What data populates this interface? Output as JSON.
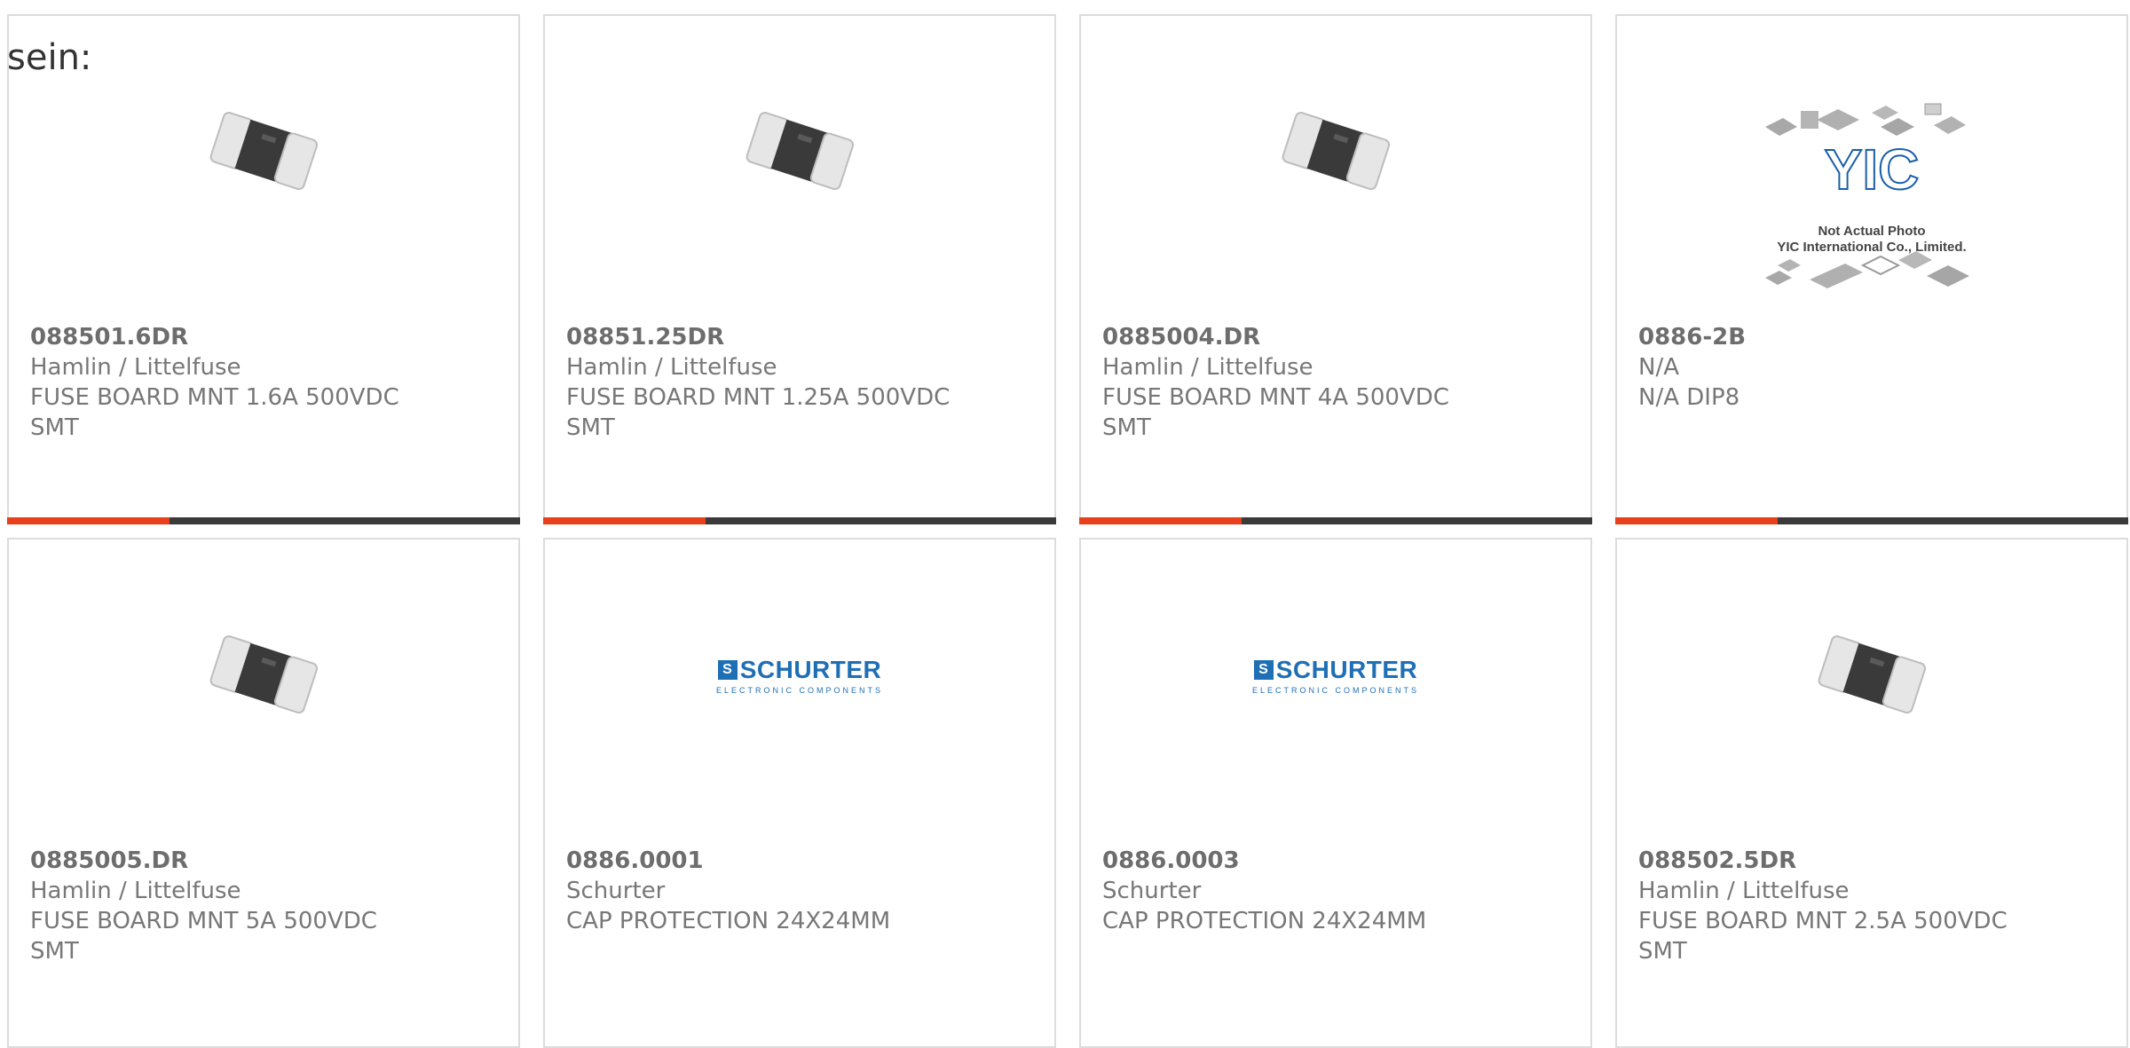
{
  "page": {
    "label": "sein:"
  },
  "colors": {
    "accent": "#e8401c",
    "bar": "#3a3a3a",
    "border": "#dcdcdc",
    "text": "#777777",
    "schurter_blue": "#1f6fb5"
  },
  "products": [
    {
      "part_number": "088501.6DR",
      "manufacturer": "Hamlin / Littelfuse",
      "description": "FUSE BOARD MNT 1.6A 500VDC",
      "package": "SMT",
      "image": "smd-fuse-icon"
    },
    {
      "part_number": "08851.25DR",
      "manufacturer": "Hamlin / Littelfuse",
      "description": "FUSE BOARD MNT 1.25A 500VDC",
      "package": "SMT",
      "image": "smd-fuse-icon"
    },
    {
      "part_number": "0885004.DR",
      "manufacturer": "Hamlin / Littelfuse",
      "description": "FUSE BOARD MNT 4A 500VDC",
      "package": "SMT",
      "image": "smd-fuse-icon"
    },
    {
      "part_number": "0886-2B",
      "manufacturer": "N/A",
      "description": "N/A DIP8",
      "package": "",
      "image": "yic-placeholder-logo",
      "image_caption": [
        "Not Actual Photo",
        "YIC International Co., Limited."
      ]
    },
    {
      "part_number": "0885005.DR",
      "manufacturer": "Hamlin / Littelfuse",
      "description": "FUSE BOARD MNT 5A 500VDC",
      "package": "SMT",
      "image": "smd-fuse-icon"
    },
    {
      "part_number": "0886.0001",
      "manufacturer": "Schurter",
      "description": "CAP PROTECTION 24X24MM",
      "package": "",
      "image": "schurter-logo",
      "logo_text": "SCHURTER",
      "logo_sub": "ELECTRONIC COMPONENTS"
    },
    {
      "part_number": "0886.0003",
      "manufacturer": "Schurter",
      "description": "CAP PROTECTION 24X24MM",
      "package": "",
      "image": "schurter-logo",
      "logo_text": "SCHURTER",
      "logo_sub": "ELECTRONIC COMPONENTS"
    },
    {
      "part_number": "088502.5DR",
      "manufacturer": "Hamlin / Littelfuse",
      "description": "FUSE BOARD MNT 2.5A 500VDC",
      "package": "SMT",
      "image": "smd-fuse-icon"
    }
  ]
}
